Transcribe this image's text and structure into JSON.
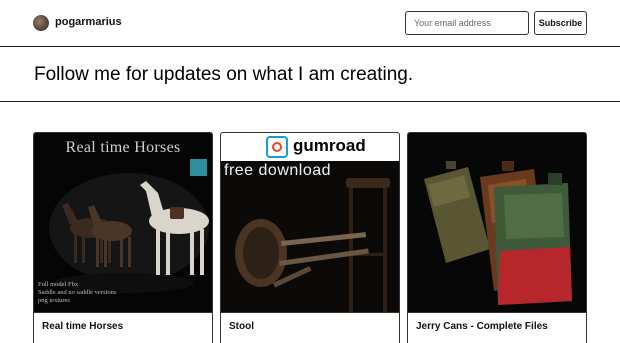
{
  "header": {
    "username": "pogarmarius",
    "email_placeholder": "Your email address",
    "subscribe_label": "Subscribe"
  },
  "hero": {
    "title": "Follow me for updates on what I am creating."
  },
  "cards": [
    {
      "title": "Real time Horses",
      "image_heading": "Real time Horses",
      "image_notes": [
        "Full model Fbx",
        "Saddle and no saddle versions",
        "png textures"
      ]
    },
    {
      "title": "Stool",
      "image_brand": "gumroad",
      "image_heading": "free download"
    },
    {
      "title": "Jerry Cans - Complete Files"
    }
  ],
  "colors": {
    "border": "#1f1f1f",
    "gumroad_blue": "#1c9ad6",
    "gumroad_red": "#e8452d"
  }
}
